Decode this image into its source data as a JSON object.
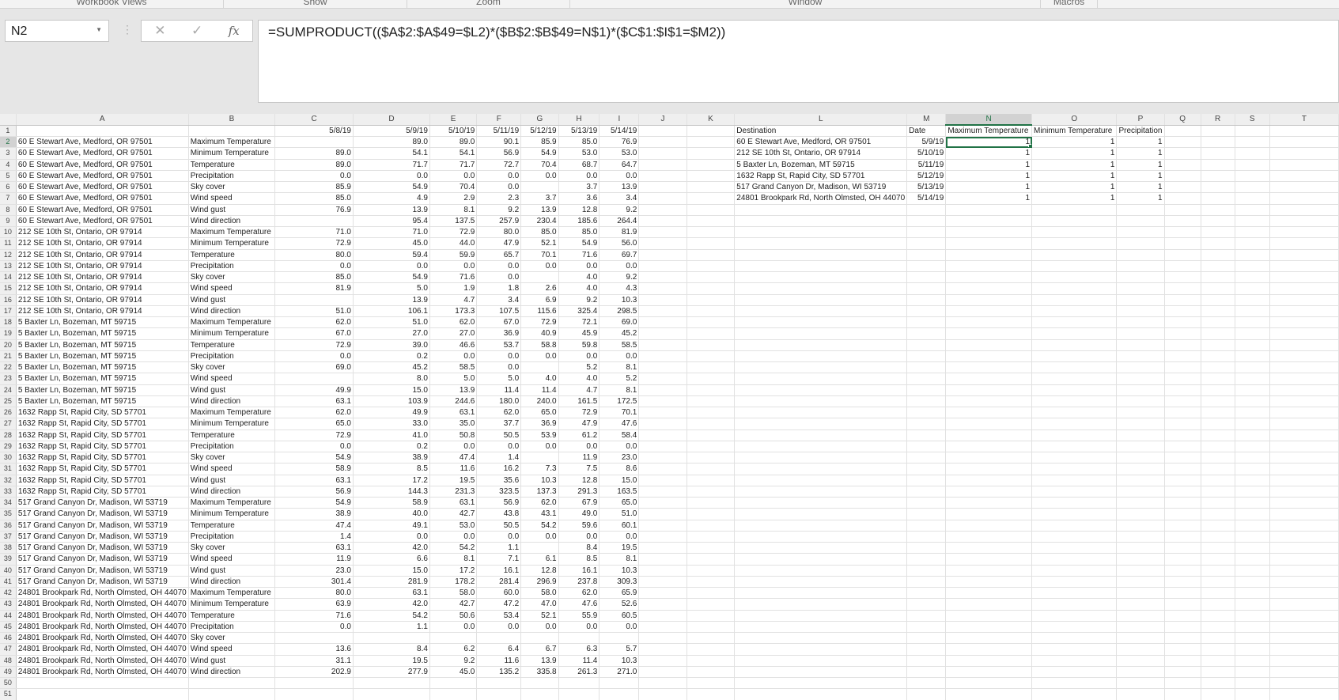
{
  "ribbon_groups": [
    "Workbook Views",
    "Show",
    "Zoom",
    "Window",
    "Macros"
  ],
  "name_box": "N2",
  "formula_bar": {
    "cancel": "✕",
    "enter": "✓",
    "fx": "fx",
    "formula": "=SUMPRODUCT(($A$2:$A$49=$L2)*($B$2:$B$49=N$1)*($C$1:$I$1=$M2))"
  },
  "columns": [
    "A",
    "B",
    "C",
    "D",
    "E",
    "F",
    "G",
    "H",
    "I",
    "J",
    "K",
    "L",
    "M",
    "N",
    "O",
    "P",
    "Q",
    "R",
    "S",
    "T"
  ],
  "selected_cell": "N2",
  "rows": [
    [
      "",
      "",
      "5/8/19",
      "5/9/19",
      "5/10/19",
      "5/11/19",
      "5/12/19",
      "5/13/19",
      "5/14/19"
    ],
    [
      "60 E Stewart Ave, Medford, OR 97501",
      "Maximum Temperature",
      "",
      "89.0",
      "89.0",
      "90.1",
      "85.9",
      "85.0",
      "76.9"
    ],
    [
      "60 E Stewart Ave, Medford, OR 97501",
      "Minimum Temperature",
      "89.0",
      "54.1",
      "54.1",
      "56.9",
      "54.9",
      "53.0",
      "53.0"
    ],
    [
      "60 E Stewart Ave, Medford, OR 97501",
      "Temperature",
      "89.0",
      "71.7",
      "71.7",
      "72.7",
      "70.4",
      "68.7",
      "64.7"
    ],
    [
      "60 E Stewart Ave, Medford, OR 97501",
      "Precipitation",
      "0.0",
      "0.0",
      "0.0",
      "0.0",
      "0.0",
      "0.0",
      "0.0"
    ],
    [
      "60 E Stewart Ave, Medford, OR 97501",
      "Sky cover",
      "85.9",
      "54.9",
      "70.4",
      "0.0",
      "",
      "3.7",
      "13.9"
    ],
    [
      "60 E Stewart Ave, Medford, OR 97501",
      "Wind speed",
      "85.0",
      "4.9",
      "2.9",
      "2.3",
      "3.7",
      "3.6",
      "3.4"
    ],
    [
      "60 E Stewart Ave, Medford, OR 97501",
      "Wind gust",
      "76.9",
      "13.9",
      "8.1",
      "9.2",
      "13.9",
      "12.8",
      "9.2"
    ],
    [
      "60 E Stewart Ave, Medford, OR 97501",
      "Wind direction",
      "",
      "95.4",
      "137.5",
      "257.9",
      "230.4",
      "185.6",
      "264.4"
    ],
    [
      "212 SE 10th St, Ontario, OR 97914",
      "Maximum Temperature",
      "71.0",
      "71.0",
      "72.9",
      "80.0",
      "85.0",
      "85.0",
      "81.9"
    ],
    [
      "212 SE 10th St, Ontario, OR 97914",
      "Minimum Temperature",
      "72.9",
      "45.0",
      "44.0",
      "47.9",
      "52.1",
      "54.9",
      "56.0"
    ],
    [
      "212 SE 10th St, Ontario, OR 97914",
      "Temperature",
      "80.0",
      "59.4",
      "59.9",
      "65.7",
      "70.1",
      "71.6",
      "69.7"
    ],
    [
      "212 SE 10th St, Ontario, OR 97914",
      "Precipitation",
      "0.0",
      "0.0",
      "0.0",
      "0.0",
      "0.0",
      "0.0",
      "0.0"
    ],
    [
      "212 SE 10th St, Ontario, OR 97914",
      "Sky cover",
      "85.0",
      "54.9",
      "71.6",
      "0.0",
      "",
      "4.0",
      "9.2"
    ],
    [
      "212 SE 10th St, Ontario, OR 97914",
      "Wind speed",
      "81.9",
      "5.0",
      "1.9",
      "1.8",
      "2.6",
      "4.0",
      "4.3"
    ],
    [
      "212 SE 10th St, Ontario, OR 97914",
      "Wind gust",
      "",
      "13.9",
      "4.7",
      "3.4",
      "6.9",
      "9.2",
      "10.3"
    ],
    [
      "212 SE 10th St, Ontario, OR 97914",
      "Wind direction",
      "51.0",
      "106.1",
      "173.3",
      "107.5",
      "115.6",
      "325.4",
      "298.5"
    ],
    [
      "5 Baxter Ln, Bozeman, MT 59715",
      "Maximum Temperature",
      "62.0",
      "51.0",
      "62.0",
      "67.0",
      "72.9",
      "72.1",
      "69.0"
    ],
    [
      "5 Baxter Ln, Bozeman, MT 59715",
      "Minimum Temperature",
      "67.0",
      "27.0",
      "27.0",
      "36.9",
      "40.9",
      "45.9",
      "45.2"
    ],
    [
      "5 Baxter Ln, Bozeman, MT 59715",
      "Temperature",
      "72.9",
      "39.0",
      "46.6",
      "53.7",
      "58.8",
      "59.8",
      "58.5"
    ],
    [
      "5 Baxter Ln, Bozeman, MT 59715",
      "Precipitation",
      "0.0",
      "0.2",
      "0.0",
      "0.0",
      "0.0",
      "0.0",
      "0.0"
    ],
    [
      "5 Baxter Ln, Bozeman, MT 59715",
      "Sky cover",
      "69.0",
      "45.2",
      "58.5",
      "0.0",
      "",
      "5.2",
      "8.1"
    ],
    [
      "5 Baxter Ln, Bozeman, MT 59715",
      "Wind speed",
      "",
      "8.0",
      "5.0",
      "5.0",
      "4.0",
      "4.0",
      "5.2"
    ],
    [
      "5 Baxter Ln, Bozeman, MT 59715",
      "Wind gust",
      "49.9",
      "15.0",
      "13.9",
      "11.4",
      "11.4",
      "4.7",
      "8.1"
    ],
    [
      "5 Baxter Ln, Bozeman, MT 59715",
      "Wind direction",
      "63.1",
      "103.9",
      "244.6",
      "180.0",
      "240.0",
      "161.5",
      "172.5"
    ],
    [
      "1632 Rapp St, Rapid City, SD 57701",
      "Maximum Temperature",
      "62.0",
      "49.9",
      "63.1",
      "62.0",
      "65.0",
      "72.9",
      "70.1"
    ],
    [
      "1632 Rapp St, Rapid City, SD 57701",
      "Minimum Temperature",
      "65.0",
      "33.0",
      "35.0",
      "37.7",
      "36.9",
      "47.9",
      "47.6"
    ],
    [
      "1632 Rapp St, Rapid City, SD 57701",
      "Temperature",
      "72.9",
      "41.0",
      "50.8",
      "50.5",
      "53.9",
      "61.2",
      "58.4"
    ],
    [
      "1632 Rapp St, Rapid City, SD 57701",
      "Precipitation",
      "0.0",
      "0.2",
      "0.0",
      "0.0",
      "0.0",
      "0.0",
      "0.0"
    ],
    [
      "1632 Rapp St, Rapid City, SD 57701",
      "Sky cover",
      "54.9",
      "38.9",
      "47.4",
      "1.4",
      "",
      "11.9",
      "23.0"
    ],
    [
      "1632 Rapp St, Rapid City, SD 57701",
      "Wind speed",
      "58.9",
      "8.5",
      "11.6",
      "16.2",
      "7.3",
      "7.5",
      "8.6"
    ],
    [
      "1632 Rapp St, Rapid City, SD 57701",
      "Wind gust",
      "63.1",
      "17.2",
      "19.5",
      "35.6",
      "10.3",
      "12.8",
      "15.0"
    ],
    [
      "1632 Rapp St, Rapid City, SD 57701",
      "Wind direction",
      "56.9",
      "144.3",
      "231.3",
      "323.5",
      "137.3",
      "291.3",
      "163.5"
    ],
    [
      "517 Grand Canyon Dr, Madison, WI 53719",
      "Maximum Temperature",
      "54.9",
      "58.9",
      "63.1",
      "56.9",
      "62.0",
      "67.9",
      "65.0"
    ],
    [
      "517 Grand Canyon Dr, Madison, WI 53719",
      "Minimum Temperature",
      "38.9",
      "40.0",
      "42.7",
      "43.8",
      "43.1",
      "49.0",
      "51.0"
    ],
    [
      "517 Grand Canyon Dr, Madison, WI 53719",
      "Temperature",
      "47.4",
      "49.1",
      "53.0",
      "50.5",
      "54.2",
      "59.6",
      "60.1"
    ],
    [
      "517 Grand Canyon Dr, Madison, WI 53719",
      "Precipitation",
      "1.4",
      "0.0",
      "0.0",
      "0.0",
      "0.0",
      "0.0",
      "0.0"
    ],
    [
      "517 Grand Canyon Dr, Madison, WI 53719",
      "Sky cover",
      "63.1",
      "42.0",
      "54.2",
      "1.1",
      "",
      "8.4",
      "19.5"
    ],
    [
      "517 Grand Canyon Dr, Madison, WI 53719",
      "Wind speed",
      "11.9",
      "6.6",
      "8.1",
      "7.1",
      "6.1",
      "8.5",
      "8.1"
    ],
    [
      "517 Grand Canyon Dr, Madison, WI 53719",
      "Wind gust",
      "23.0",
      "15.0",
      "17.2",
      "16.1",
      "12.8",
      "16.1",
      "10.3"
    ],
    [
      "517 Grand Canyon Dr, Madison, WI 53719",
      "Wind direction",
      "301.4",
      "281.9",
      "178.2",
      "281.4",
      "296.9",
      "237.8",
      "309.3"
    ],
    [
      "24801 Brookpark Rd, North Olmsted, OH 44070",
      "Maximum Temperature",
      "80.0",
      "63.1",
      "58.0",
      "60.0",
      "58.0",
      "62.0",
      "65.9"
    ],
    [
      "24801 Brookpark Rd, North Olmsted, OH 44070",
      "Minimum Temperature",
      "63.9",
      "42.0",
      "42.7",
      "47.2",
      "47.0",
      "47.6",
      "52.6"
    ],
    [
      "24801 Brookpark Rd, North Olmsted, OH 44070",
      "Temperature",
      "71.6",
      "54.2",
      "50.6",
      "53.4",
      "52.1",
      "55.9",
      "60.5"
    ],
    [
      "24801 Brookpark Rd, North Olmsted, OH 44070",
      "Precipitation",
      "0.0",
      "1.1",
      "0.0",
      "0.0",
      "0.0",
      "0.0",
      "0.0"
    ],
    [
      "24801 Brookpark Rd, North Olmsted, OH 44070",
      "Sky cover",
      "",
      "",
      "",
      "",
      "",
      "",
      ""
    ],
    [
      "24801 Brookpark Rd, North Olmsted, OH 44070",
      "Wind speed",
      "13.6",
      "8.4",
      "6.2",
      "6.4",
      "6.7",
      "6.3",
      "5.7"
    ],
    [
      "24801 Brookpark Rd, North Olmsted, OH 44070",
      "Wind gust",
      "31.1",
      "19.5",
      "9.2",
      "11.6",
      "13.9",
      "11.4",
      "10.3"
    ],
    [
      "24801 Brookpark Rd, North Olmsted, OH 44070",
      "Wind direction",
      "202.9",
      "277.9",
      "45.0",
      "135.2",
      "335.8",
      "261.3",
      "271.0"
    ]
  ],
  "lookup_table": [
    [
      "Destination",
      "Date",
      "Maximum Temperature",
      "Minimum Temperature",
      "Precipitation"
    ],
    [
      "60 E Stewart Ave, Medford, OR 97501",
      "5/9/19",
      "1",
      "1",
      "1"
    ],
    [
      "212 SE 10th St, Ontario, OR 97914",
      "5/10/19",
      "1",
      "1",
      "1"
    ],
    [
      "5 Baxter Ln, Bozeman, MT 59715",
      "5/11/19",
      "1",
      "1",
      "1"
    ],
    [
      "1632 Rapp St, Rapid City, SD 57701",
      "5/12/19",
      "1",
      "1",
      "1"
    ],
    [
      "517 Grand Canyon Dr, Madison, WI 53719",
      "5/13/19",
      "1",
      "1",
      "1"
    ],
    [
      "24801 Brookpark Rd, North Olmsted, OH 44070",
      "5/14/19",
      "1",
      "1",
      "1"
    ]
  ],
  "row_count": 51
}
